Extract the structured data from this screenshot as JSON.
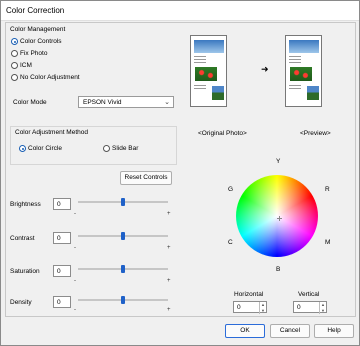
{
  "window": {
    "title": "Color Correction"
  },
  "color_management": {
    "heading": "Color Management",
    "options": [
      {
        "label": "Color Controls",
        "selected": true
      },
      {
        "label": "Fix Photo",
        "selected": false
      },
      {
        "label": "ICM",
        "selected": false
      },
      {
        "label": "No Color Adjustment",
        "selected": false
      }
    ]
  },
  "color_mode": {
    "label": "Color Mode",
    "value": "EPSON Vivid"
  },
  "adjustment_method": {
    "heading": "Color Adjustment Method",
    "options": [
      {
        "label": "Color Circle",
        "selected": true
      },
      {
        "label": "Slide Bar",
        "selected": false
      }
    ]
  },
  "reset_label": "Reset Controls",
  "sliders": [
    {
      "label": "Brightness",
      "value": "0",
      "min_sign": "-",
      "max_sign": "+"
    },
    {
      "label": "Contrast",
      "value": "0",
      "min_sign": "-",
      "max_sign": "+"
    },
    {
      "label": "Saturation",
      "value": "0",
      "min_sign": "-",
      "max_sign": "+"
    },
    {
      "label": "Density",
      "value": "0",
      "min_sign": "-",
      "max_sign": "+"
    }
  ],
  "preview": {
    "original_label": "<Original Photo>",
    "preview_label": "<Preview>",
    "arrow": "➜"
  },
  "color_circle": {
    "Y": "Y",
    "G": "G",
    "R": "R",
    "C": "C",
    "M": "M",
    "B": "B"
  },
  "horizontal": {
    "label": "Horizontal",
    "value": "0"
  },
  "vertical": {
    "label": "Vertical",
    "value": "0"
  },
  "buttons": {
    "ok": "OK",
    "cancel": "Cancel",
    "help": "Help"
  },
  "colors": {
    "accent": "#1a5fb4"
  }
}
